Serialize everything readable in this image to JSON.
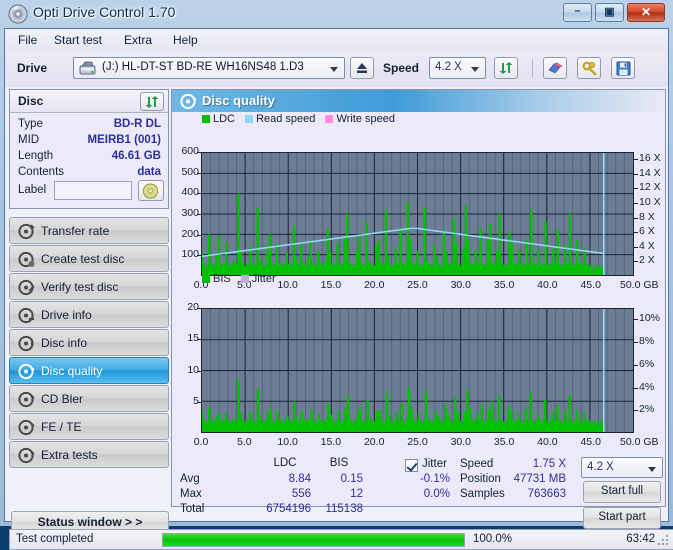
{
  "window": {
    "title": "Opti Drive Control 1.70",
    "icon": "disc-icon",
    "buttons": {
      "minimize": "–",
      "maximize": "▣",
      "close": "✕"
    }
  },
  "menu": {
    "items": [
      {
        "label": "File"
      },
      {
        "label": "Start test"
      },
      {
        "label": "Extra"
      },
      {
        "label": "Help"
      }
    ]
  },
  "toolbar": {
    "drive_label": "Drive",
    "drive_value": "(J:)  HL-DT-ST BD-RE  WH16NS48 1.D3",
    "speed_label": "Speed",
    "speed_value": "4.2 X",
    "icons": [
      "drive-icon",
      "eject-icon",
      "refresh-icon",
      "erase-icon",
      "tools-icon",
      "save-icon"
    ]
  },
  "disc": {
    "header": "Disc",
    "rows": [
      {
        "key": "Type",
        "value": "BD-R DL"
      },
      {
        "key": "MID",
        "value": "MEIRB1 (001)"
      },
      {
        "key": "Length",
        "value": "46.61 GB"
      },
      {
        "key": "Contents",
        "value": "data"
      }
    ],
    "label_key": "Label",
    "label_value": "",
    "label_placeholder": ""
  },
  "nav": {
    "items": [
      {
        "label": "Transfer rate",
        "selected": false
      },
      {
        "label": "Create test disc",
        "selected": false
      },
      {
        "label": "Verify test disc",
        "selected": false
      },
      {
        "label": "Drive info",
        "selected": false
      },
      {
        "label": "Disc info",
        "selected": false
      },
      {
        "label": "Disc quality",
        "selected": true
      },
      {
        "label": "CD Bler",
        "selected": false
      },
      {
        "label": "FE / TE",
        "selected": false
      },
      {
        "label": "Extra tests",
        "selected": false
      }
    ],
    "status_window_label": "Status window > >"
  },
  "panel": {
    "title": "Disc quality",
    "icon": "disc-quality-icon"
  },
  "results": {
    "col_headers": [
      "LDC",
      "BIS"
    ],
    "rows": [
      {
        "label": "Avg",
        "ldc": "8.84",
        "bis": "0.15"
      },
      {
        "label": "Max",
        "ldc": "556",
        "bis": "12"
      },
      {
        "label": "Total",
        "ldc": "6754196",
        "bis": "115138"
      }
    ],
    "jitter_label": "Jitter",
    "jitter_checked": true,
    "jitter_values": [
      "-0.1%",
      "0.0%"
    ],
    "speed_label": "Speed",
    "speed_value": "1.75 X",
    "position_label": "Position",
    "position_value": "47731 MB",
    "samples_label": "Samples",
    "samples_value": "763663",
    "speed_select": "4.2 X",
    "start_full_label": "Start full",
    "start_part_label": "Start part"
  },
  "statusbar": {
    "text": "Test completed",
    "percent": "100.0%",
    "time": "63:42",
    "progress": 100
  },
  "colors": {
    "ldc": "#00c000",
    "bis": "#00c000",
    "read_speed": "#8fd8f2",
    "write_speed": "#ff8fd8",
    "jitter": "#c9a8d8",
    "plot_bg": "#6d7d96",
    "accent": "#2b2f9e"
  },
  "chart_data": [
    {
      "type": "bar",
      "name": "ldc-chart",
      "title": "",
      "xlabel": "GB",
      "ylabel": "",
      "legend": [
        {
          "label": "LDC",
          "color": "#00c000"
        },
        {
          "label": "Read speed",
          "color": "#8fd8f2"
        },
        {
          "label": "Write speed",
          "color": "#ff8fd8"
        }
      ],
      "legend_position": "top-left",
      "grid": true,
      "xlim": [
        0,
        50
      ],
      "xticks": [
        "0.0",
        "5.0",
        "10.0",
        "15.0",
        "20.0",
        "25.0",
        "30.0",
        "35.0",
        "40.0",
        "45.0",
        "50.0"
      ],
      "x_unit": "GB",
      "ylim": [
        0,
        600
      ],
      "yticks": [
        "100",
        "200",
        "300",
        "400",
        "500",
        "600"
      ],
      "y2lim": [
        0,
        17
      ],
      "y2ticks": [
        "2 X",
        "4 X",
        "6 X",
        "8 X",
        "10 X",
        "12 X",
        "14 X",
        "16 X"
      ],
      "series": [
        {
          "name": "LDC",
          "type": "bar",
          "color": "#00c000",
          "values": [
            120,
            60,
            45,
            200,
            55,
            38,
            95,
            190,
            42,
            60,
            160,
            50,
            44,
            70,
            52,
            400,
            120,
            58,
            46,
            62,
            140,
            55,
            48,
            330,
            80,
            50,
            44,
            120,
            200,
            58,
            42,
            150,
            60,
            46,
            52,
            110,
            58,
            44,
            240,
            90,
            48,
            150,
            62,
            44,
            86,
            170,
            52,
            48,
            120,
            58,
            44,
            70,
            230,
            110,
            48,
            56,
            160,
            52,
            46,
            180,
            300,
            64,
            50,
            46,
            120,
            200,
            58,
            44,
            260,
            70,
            52,
            46,
            150,
            170,
            60,
            48,
            320,
            90,
            52,
            44,
            130,
            58,
            230,
            46,
            60,
            360,
            180,
            62,
            48,
            120,
            52,
            44,
            330,
            70,
            58,
            46,
            150,
            90,
            52,
            44,
            220,
            120,
            60,
            48,
            280,
            160,
            54,
            46,
            130,
            340,
            180,
            62,
            48,
            120,
            58,
            230,
            52,
            46,
            170,
            250,
            64,
            48,
            120,
            300,
            58,
            50,
            46,
            210,
            160,
            62,
            48,
            130,
            58,
            44,
            180,
            52,
            320,
            60,
            46,
            120,
            58,
            44,
            260,
            52,
            48,
            130,
            60,
            220,
            52,
            46,
            150,
            58,
            300,
            48,
            52,
            170,
            60,
            44,
            130,
            52,
            48,
            0,
            0,
            0,
            0,
            0
          ]
        },
        {
          "name": "Read speed",
          "type": "line",
          "color": "#8fd8f2",
          "unit": "X",
          "description": "rises from ~2.5X at 0 GB to ~6.5X around 27 GB, then declines to ~2.5X at 46.6 GB",
          "values": [
            2.6,
            2.7,
            2.8,
            2.9,
            3.0,
            3.1,
            3.2,
            3.3,
            3.4,
            3.5,
            3.6,
            3.7,
            3.8,
            3.9,
            4.0,
            4.1,
            4.2,
            4.3,
            4.4,
            4.5,
            4.6,
            4.7,
            4.8,
            4.9,
            5.0,
            5.1,
            5.2,
            5.3,
            5.4,
            5.5,
            5.6,
            5.7,
            5.8,
            5.9,
            6.0,
            6.1,
            6.2,
            6.3,
            6.4,
            6.5,
            6.5,
            6.4,
            6.3,
            6.2,
            6.1,
            6.0,
            5.9,
            5.8,
            5.7,
            5.6,
            5.5,
            5.4,
            5.3,
            5.2,
            5.1,
            5.0,
            4.9,
            4.8,
            4.7,
            4.6,
            4.5,
            4.4,
            4.3,
            4.2,
            4.1,
            4.0,
            3.9,
            3.8,
            3.7,
            3.6,
            3.5,
            3.4,
            3.3,
            3.2,
            3.1,
            3.0
          ]
        }
      ]
    },
    {
      "type": "bar",
      "name": "bis-chart",
      "title": "",
      "xlabel": "GB",
      "ylabel": "",
      "legend": [
        {
          "label": "BIS",
          "color": "#00c000"
        },
        {
          "label": "Jitter",
          "color": "#c9a8d8"
        }
      ],
      "legend_position": "top-left",
      "grid": true,
      "xlim": [
        0,
        50
      ],
      "xticks": [
        "0.0",
        "5.0",
        "10.0",
        "15.0",
        "20.0",
        "25.0",
        "30.0",
        "35.0",
        "40.0",
        "45.0",
        "50.0"
      ],
      "x_unit": "GB",
      "ylim": [
        0,
        20
      ],
      "yticks": [
        "5",
        "10",
        "15",
        "20"
      ],
      "y2lim": [
        0,
        11
      ],
      "y2ticks": [
        "2%",
        "4%",
        "6%",
        "8%",
        "10%"
      ],
      "series": [
        {
          "name": "BIS",
          "type": "bar",
          "color": "#00c000",
          "values": [
            3.5,
            2.0,
            1.5,
            4.0,
            1.8,
            1.2,
            2.5,
            3.2,
            1.4,
            2.0,
            3.0,
            1.6,
            1.3,
            2.2,
            1.5,
            8.5,
            3.0,
            1.8,
            1.4,
            2.0,
            3.4,
            1.7,
            1.5,
            7.0,
            2.4,
            1.6,
            1.4,
            3.0,
            4.0,
            1.8,
            1.3,
            3.4,
            2.0,
            1.5,
            1.7,
            2.6,
            1.8,
            1.4,
            5.0,
            2.4,
            1.5,
            3.4,
            2.0,
            1.4,
            2.2,
            3.6,
            1.6,
            1.5,
            3.0,
            1.8,
            1.4,
            2.2,
            4.6,
            2.8,
            1.5,
            1.8,
            3.4,
            1.6,
            1.5,
            3.8,
            6.0,
            2.0,
            1.6,
            1.5,
            3.0,
            4.0,
            1.8,
            1.4,
            5.2,
            2.2,
            1.6,
            1.5,
            3.4,
            3.6,
            1.9,
            1.5,
            6.4,
            2.6,
            1.6,
            1.4,
            3.2,
            1.8,
            4.6,
            1.5,
            1.9,
            7.2,
            3.8,
            2.0,
            1.5,
            3.0,
            1.6,
            1.4,
            6.6,
            2.2,
            1.8,
            1.5,
            3.4,
            2.6,
            1.6,
            1.4,
            4.4,
            3.0,
            1.9,
            1.5,
            5.6,
            3.4,
            1.7,
            1.5,
            3.2,
            6.8,
            3.8,
            2.0,
            1.5,
            3.0,
            1.8,
            4.6,
            1.6,
            1.5,
            3.6,
            5.0,
            2.0,
            1.5,
            6.0,
            1.8,
            1.6,
            1.5,
            4.2,
            3.4,
            2.0,
            1.5,
            3.2,
            1.8,
            1.4,
            3.8,
            1.6,
            6.4,
            1.9,
            1.5,
            3.0,
            1.8,
            1.4,
            5.2,
            1.6,
            1.5,
            3.2,
            1.9,
            4.4,
            1.6,
            1.5,
            3.4,
            1.8,
            6.0,
            1.5,
            1.6,
            3.6,
            1.9,
            1.4,
            3.2,
            1.6,
            1.5,
            0,
            0,
            0,
            0,
            0
          ]
        },
        {
          "name": "Jitter",
          "type": "line",
          "color": "#c9a8d8",
          "unit": "%",
          "values": []
        }
      ]
    }
  ]
}
